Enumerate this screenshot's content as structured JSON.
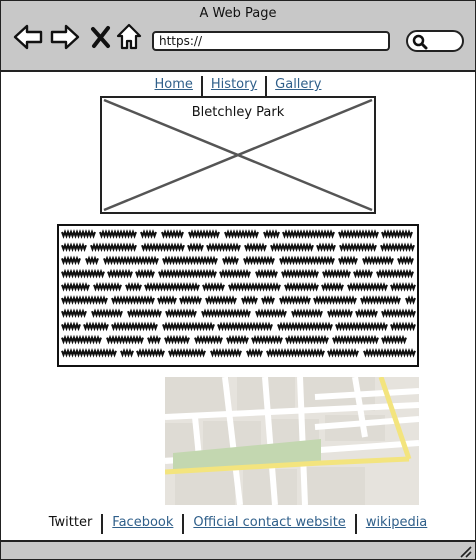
{
  "window": {
    "title": "A Web Page"
  },
  "toolbar": {
    "back_icon": "arrow-left-icon",
    "forward_icon": "arrow-right-icon",
    "stop_icon": "close-icon",
    "home_icon": "home-icon",
    "url": "https://",
    "search_icon": "search-icon"
  },
  "nav": {
    "links": [
      "Home",
      "History",
      "Gallery"
    ]
  },
  "hero": {
    "caption": "Bletchley Park"
  },
  "body_text": {
    "style": "scribbled-placeholder"
  },
  "map": {
    "type": "street-map-placeholder"
  },
  "footer": {
    "current": "Twitter",
    "links": [
      "Facebook",
      "Official contact website",
      "wikipedia"
    ]
  },
  "colors": {
    "chrome": "#c8c8c8",
    "link": "#2f5f8a",
    "map_bg": "#e9e6e1",
    "map_park": "#c3d7b0",
    "map_highway": "#f3e47e"
  }
}
